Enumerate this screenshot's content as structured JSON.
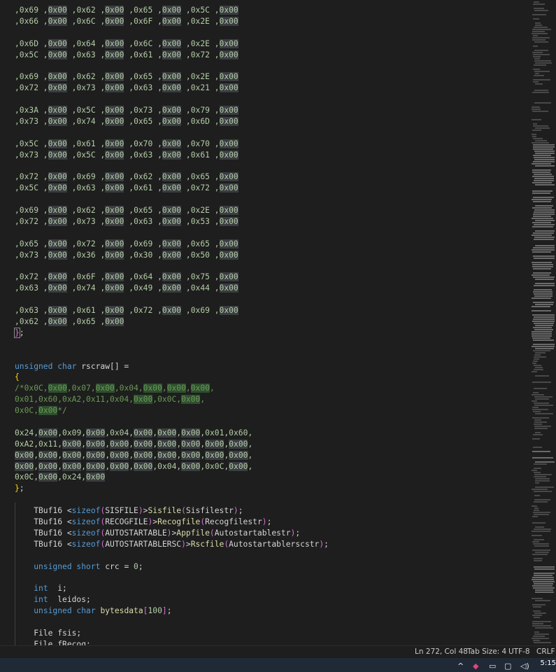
{
  "code": {
    "hex_block": [
      [
        [
          "0x69",
          "0x00"
        ],
        [
          "0x62",
          "0x00"
        ],
        [
          "0x65",
          "0x00"
        ],
        [
          "0x5C",
          "0x00"
        ]
      ],
      [
        [
          "0x66",
          "0x00"
        ],
        [
          "0x6C",
          "0x00"
        ],
        [
          "0x6F",
          "0x00"
        ],
        [
          "0x2E",
          "0x00"
        ]
      ],
      null,
      [
        [
          "0x6D",
          "0x00"
        ],
        [
          "0x64",
          "0x00"
        ],
        [
          "0x6C",
          "0x00"
        ],
        [
          "0x2E",
          "0x00"
        ]
      ],
      [
        [
          "0x5C",
          "0x00"
        ],
        [
          "0x63",
          "0x00"
        ],
        [
          "0x61",
          "0x00"
        ],
        [
          "0x72",
          "0x00"
        ]
      ],
      null,
      [
        [
          "0x69",
          "0x00"
        ],
        [
          "0x62",
          "0x00"
        ],
        [
          "0x65",
          "0x00"
        ],
        [
          "0x2E",
          "0x00"
        ]
      ],
      [
        [
          "0x72",
          "0x00"
        ],
        [
          "0x73",
          "0x00"
        ],
        [
          "0x63",
          "0x00"
        ],
        [
          "0x21",
          "0x00"
        ]
      ],
      null,
      [
        [
          "0x3A",
          "0x00"
        ],
        [
          "0x5C",
          "0x00"
        ],
        [
          "0x73",
          "0x00"
        ],
        [
          "0x79",
          "0x00"
        ]
      ],
      [
        [
          "0x73",
          "0x00"
        ],
        [
          "0x74",
          "0x00"
        ],
        [
          "0x65",
          "0x00"
        ],
        [
          "0x6D",
          "0x00"
        ]
      ],
      null,
      [
        [
          "0x5C",
          "0x00"
        ],
        [
          "0x61",
          "0x00"
        ],
        [
          "0x70",
          "0x00"
        ],
        [
          "0x70",
          "0x00"
        ]
      ],
      [
        [
          "0x73",
          "0x00"
        ],
        [
          "0x5C",
          "0x00"
        ],
        [
          "0x63",
          "0x00"
        ],
        [
          "0x61",
          "0x00"
        ]
      ],
      null,
      [
        [
          "0x72",
          "0x00"
        ],
        [
          "0x69",
          "0x00"
        ],
        [
          "0x62",
          "0x00"
        ],
        [
          "0x65",
          "0x00"
        ]
      ],
      [
        [
          "0x5C",
          "0x00"
        ],
        [
          "0x63",
          "0x00"
        ],
        [
          "0x61",
          "0x00"
        ],
        [
          "0x72",
          "0x00"
        ]
      ],
      null,
      [
        [
          "0x69",
          "0x00"
        ],
        [
          "0x62",
          "0x00"
        ],
        [
          "0x65",
          "0x00"
        ],
        [
          "0x2E",
          "0x00"
        ]
      ],
      [
        [
          "0x72",
          "0x00"
        ],
        [
          "0x73",
          "0x00"
        ],
        [
          "0x63",
          "0x00"
        ],
        [
          "0x53",
          "0x00"
        ]
      ],
      null,
      [
        [
          "0x65",
          "0x00"
        ],
        [
          "0x72",
          "0x00"
        ],
        [
          "0x69",
          "0x00"
        ],
        [
          "0x65",
          "0x00"
        ]
      ],
      [
        [
          "0x73",
          "0x00"
        ],
        [
          "0x36",
          "0x00"
        ],
        [
          "0x30",
          "0x00"
        ],
        [
          "0x50",
          "0x00"
        ]
      ],
      null,
      [
        [
          "0x72",
          "0x00"
        ],
        [
          "0x6F",
          "0x00"
        ],
        [
          "0x64",
          "0x00"
        ],
        [
          "0x75",
          "0x00"
        ]
      ],
      [
        [
          "0x63",
          "0x00"
        ],
        [
          "0x74",
          "0x00"
        ],
        [
          "0x49",
          "0x00"
        ],
        [
          "0x44",
          "0x00"
        ]
      ],
      null,
      [
        [
          "0x63",
          "0x00"
        ],
        [
          "0x61",
          "0x00"
        ],
        [
          "0x72",
          "0x00"
        ],
        [
          "0x69",
          "0x00"
        ]
      ],
      [
        [
          "0x62",
          "0x00"
        ],
        [
          "0x65",
          "0x00"
        ]
      ]
    ],
    "close_bracket_line": "};",
    "rscraw_decl": {
      "keyword": "unsigned char",
      "name": "rscraw",
      "suffix": "[] ="
    },
    "open_brace": "{",
    "comment_lines": [
      [
        "/*0x0C,",
        "0x00",
        ",0x07,",
        "0x00",
        ",0x04,",
        "0x00",
        ",",
        "0x00",
        ",",
        "0x00",
        ","
      ],
      [
        "0x01,0x60,0xA2,0x11,0x04,",
        "0x00",
        ",0x0C,",
        "0x00",
        ","
      ],
      [
        "0x0C,",
        "0x00",
        "*/"
      ]
    ],
    "array_lines": [
      [
        "0x24,",
        "0x00",
        ",0x09,",
        "0x00",
        ",0x04,",
        "0x00",
        ",",
        "0x00",
        ",",
        "0x00",
        ",0x01,0x60,"
      ],
      [
        "0xA2,0x11,",
        "0x00",
        ",",
        "0x00",
        ",",
        "0x00",
        ",",
        "0x00",
        ",",
        "0x00",
        ",",
        "0x00",
        ",",
        "0x00",
        ",",
        "0x00",
        ","
      ],
      [
        "0x00",
        ",",
        "0x00",
        ",",
        "0x00",
        ",",
        "0x00",
        ",",
        "0x00",
        ",",
        "0x00",
        ",",
        "0x00",
        ",",
        "0x00",
        ",",
        "0x00",
        ",",
        "0x00",
        ","
      ],
      [
        "0x00",
        ",",
        "0x00",
        ",",
        "0x00",
        ",",
        "0x00",
        ",",
        "0x00",
        ",",
        "0x00",
        ",0x04,",
        "0x00",
        ",0x0C,",
        "0x00",
        ","
      ],
      [
        "0x0C,",
        "0x00",
        ",0x24,",
        "0x00"
      ]
    ],
    "close_brace_semicolon": "};",
    "tbuf_lines": [
      {
        "type": "TBuf16",
        "arg": "SISFILE",
        "var": "Sisfile",
        "init": "Sisfilestr"
      },
      {
        "type": "TBuf16",
        "arg": "RECOGFILE",
        "var": "Recogfile",
        "init": "Recogfilestr"
      },
      {
        "type": "TBuf16",
        "arg": "AUTOSTARTABLE",
        "var": "Appfile",
        "init": "Autostartablestr"
      },
      {
        "type": "TBuf16",
        "arg": "AUTOSTARTABLERSC",
        "var": "Rscfile",
        "init": "Autostartablerscstr"
      }
    ],
    "sizeof_kw": "sizeof",
    "crc_line": {
      "kw": "unsigned short",
      "rest": " crc = ",
      "num": "0",
      "end": ";"
    },
    "int_i": {
      "kw": "int",
      "rest": "  i;"
    },
    "int_leidos": {
      "kw": "int",
      "rest": "  leidos;"
    },
    "bytesdata": {
      "kw": "unsigned char",
      "name": "bytesdata",
      "num": "100"
    },
    "file_fsis": "File fsis;",
    "file_frecog": "File fRecog;"
  },
  "status": {
    "position": "Ln 272, Col 48",
    "tab_size": "Tab Size: 4",
    "encoding": "UTF-8",
    "eol": "CRLF"
  },
  "taskbar": {
    "time": "5:15"
  }
}
